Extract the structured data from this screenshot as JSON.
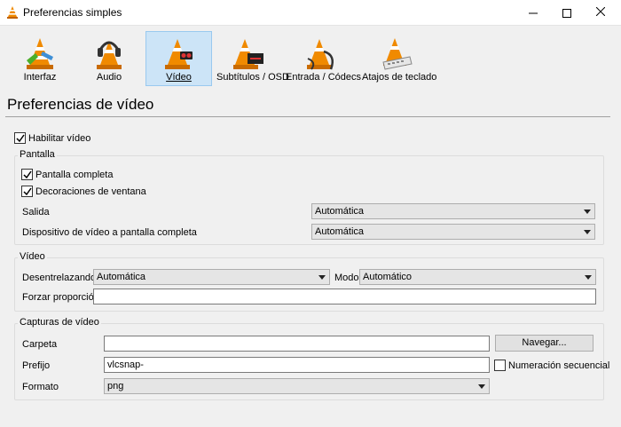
{
  "window": {
    "title": "Preferencias simples"
  },
  "toolbar": {
    "items": [
      {
        "label": "Interfaz",
        "icon": "cone-interface-icon"
      },
      {
        "label": "Audio",
        "icon": "cone-headphones-icon"
      },
      {
        "label": "Vídeo",
        "icon": "cone-video-icon",
        "active": true
      },
      {
        "label": "Subtítulos / OSD",
        "icon": "cone-subtitles-icon"
      },
      {
        "label": "Entrada / Códecs",
        "icon": "cone-cable-icon"
      },
      {
        "label": "Atajos de teclado",
        "icon": "cone-keyboard-icon"
      }
    ]
  },
  "page": {
    "title": "Preferencias de vídeo"
  },
  "enable_video": {
    "label": "Habilitar vídeo",
    "checked": true
  },
  "pantalla": {
    "title": "Pantalla",
    "fullscreen": {
      "label": "Pantalla completa",
      "checked": true
    },
    "decorations": {
      "label": "Decoraciones de ventana",
      "checked": true
    },
    "output": {
      "label": "Salida",
      "value": "Automática"
    },
    "fs_device": {
      "label": "Dispositivo de vídeo a pantalla completa",
      "value": "Automática"
    }
  },
  "video": {
    "title": "Vídeo",
    "deinterlace": {
      "label": "Desentrelazando",
      "value": "Automática"
    },
    "mode": {
      "label": "Modo",
      "value": "Automático"
    },
    "aspect": {
      "label": "Forzar proporción",
      "value": ""
    }
  },
  "snapshots": {
    "title": "Capturas de vídeo",
    "folder": {
      "label": "Carpeta",
      "value": ""
    },
    "browse_label": "Navegar...",
    "prefix": {
      "label": "Prefijo",
      "value": "vlcsnap-"
    },
    "sequential": {
      "label": "Numeración secuencial",
      "checked": false
    },
    "format": {
      "label": "Formato",
      "value": "png"
    }
  },
  "colors": {
    "active_tab_bg": "#cce4f7",
    "cone_orange": "#f08a00"
  }
}
